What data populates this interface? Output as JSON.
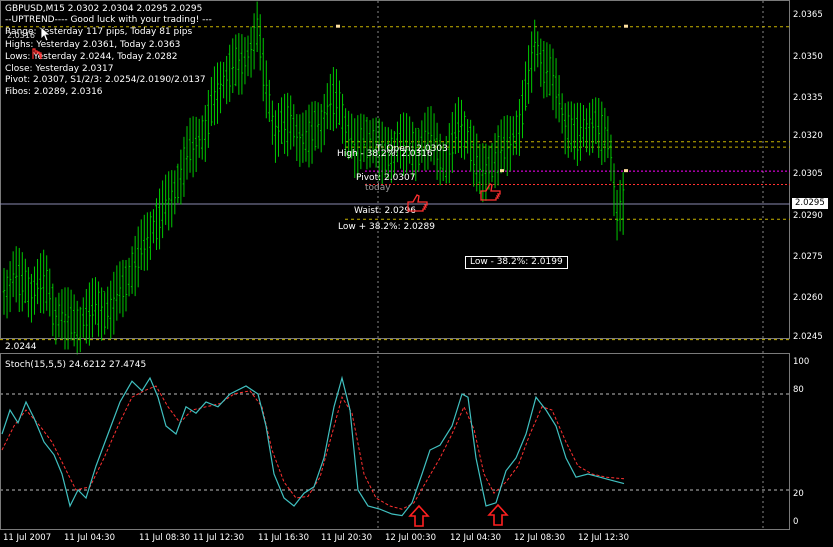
{
  "header": {
    "symbol_line": "GBPUSD,M15  2.0302 2.0304 2.0295 2.0295",
    "trend_line": "--UPTREND---- Good luck with your trading! ---",
    "range_line": "Range: Yesterday 117 pips, Today 81 pips",
    "highs_line": "Highs: Yesterday 2.0361, Today 2.0363",
    "lows_line": "Lows: Yesterday 2.0244, Today 2.0282",
    "close_line": "Close: Yesterday 2.0317",
    "pivot_line": "Pivot: 2.0307, S1/2/3: 2.0254/2.0190/2.0137",
    "fibos_line": "Fibos: 2.0289, 2.0316",
    "overlay_ghost": "2.0316"
  },
  "main_chart": {
    "price_axis": [
      "2.0365",
      "2.0350",
      "2.0335",
      "2.0320",
      "2.0305",
      "2.0290",
      "2.0275",
      "2.0260",
      "2.0245"
    ],
    "current_price": "2.0295",
    "lowest_label": "2.0244",
    "labels": {
      "today_open": "T: Open: 2.0303",
      "high_fib": "High - 38.2%: 2.0316",
      "pivot": "Pivot: 2.0307",
      "today": "today",
      "waist": "Waist: 2.0296",
      "low_fib_plus": "Low + 38.2%: 2.0289",
      "low_fib_minus": "Low - 38.2%: 2.0199"
    },
    "colors": {
      "candles": "#00c800",
      "pivot": "#ff00ff",
      "levels": "#c8b400",
      "red_level": "#ff3030"
    }
  },
  "stoch": {
    "title": "Stoch(15,5,5) 24.6212 27.4745",
    "axis": [
      "100",
      "80",
      "20",
      "0"
    ],
    "colors": {
      "main": "#40c0c0",
      "signal": "#ff3030"
    }
  },
  "time_axis": [
    "11 Jul 2007",
    "11 Jul 04:30",
    "11 Jul 08:30",
    "11 Jul 12:30",
    "11 Jul 16:30",
    "11 Jul 20:30",
    "12 Jul 00:30",
    "12 Jul 04:30",
    "12 Jul 08:30",
    "12 Jul 12:30"
  ],
  "icons": [
    "thumb-up-icon",
    "thumb-up-icon",
    "arrow-up-icon",
    "arrow-up-icon",
    "cursor-icon",
    "hand-icon"
  ]
}
